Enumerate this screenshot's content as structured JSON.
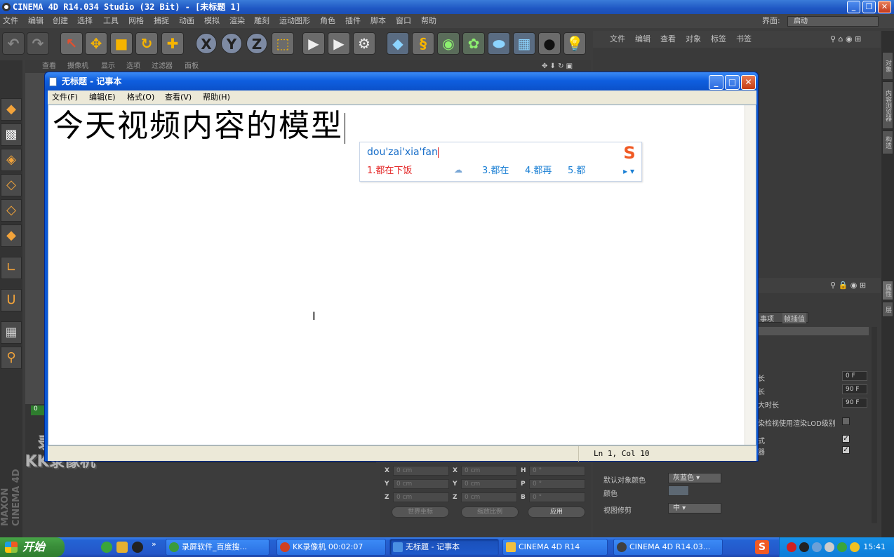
{
  "c4d": {
    "title": "CINEMA 4D R14.034 Studio (32 Bit) - [未标题 1]",
    "menu": [
      "文件",
      "编辑",
      "创建",
      "选择",
      "工具",
      "网格",
      "捕捉",
      "动画",
      "模拟",
      "渲染",
      "雕刻",
      "运动图形",
      "角色",
      "插件",
      "脚本",
      "窗口",
      "帮助"
    ],
    "layout_label": "界面:",
    "layout_value": "启动",
    "viewport_menu": [
      "查看",
      "摄像机",
      "显示",
      "选项",
      "过滤器",
      "面板"
    ],
    "right_menu": [
      "文件",
      "编辑",
      "查看",
      "对象",
      "标签",
      "书签"
    ],
    "right_tabs": [
      "对象",
      "内容浏览器",
      "构造"
    ],
    "right_tabs2": [
      "属性",
      "层"
    ],
    "attr_tabs": [
      "事项",
      "帧插值"
    ],
    "attr_rows": [
      {
        "label": "长",
        "value": "0 F"
      },
      {
        "label": "长",
        "value": "90 F"
      },
      {
        "label": "大时长",
        "value": "90 F"
      }
    ],
    "lod_label": "染检视使用渲染LOD级别",
    "row_style": "式",
    "row_renderer": "器",
    "default_color_label": "默认对象颜色",
    "default_color_value": "灰蓝色",
    "color_label": "颜色",
    "viewport_clip_label": "视图修剪",
    "viewport_clip_value": "中",
    "coords": {
      "labels": [
        "X",
        "Y",
        "Z",
        "X",
        "Y",
        "Z",
        "H",
        "P",
        "B"
      ],
      "values": [
        "0 cm",
        "0 cm",
        "0 cm",
        "0 cm",
        "0 cm",
        "0 cm",
        "0 °",
        "0 °",
        "0 °"
      ],
      "btn_world": "世界坐标",
      "btn_scale": "缩放比例",
      "btn_apply": "应用"
    },
    "timeline_frame": "0",
    "brand": "MAXON CINEMA 4D"
  },
  "watermark": {
    "line1": "录制工具",
    "line2": "KK录像机"
  },
  "notepad": {
    "title": "无标题 - 记事本",
    "menu": [
      "文件(F)",
      "编辑(E)",
      "格式(O)",
      "查看(V)",
      "帮助(H)"
    ],
    "content": "今天视频内容的模型",
    "status": "Ln 1, Col 10"
  },
  "ime": {
    "pinyin": "dou'zai'xia'fan",
    "candidates": [
      "1.都在下饭",
      "3.都在",
      "4.都再",
      "5.都"
    ],
    "logo": "S"
  },
  "taskbar": {
    "start": "开始",
    "tasks": [
      {
        "label": "录屏软件_百度搜...",
        "color": "#3b9b3b"
      },
      {
        "label": "KK录像机 00:02:07",
        "color": "#d04020"
      },
      {
        "label": "无标题 - 记事本",
        "color": "#4a90e2"
      },
      {
        "label": "CINEMA 4D R14",
        "color": "#f0c040"
      },
      {
        "label": "CINEMA 4D R14.03...",
        "color": "#404040"
      }
    ],
    "clock": "15:41",
    "quicklaunch_more": "»"
  }
}
